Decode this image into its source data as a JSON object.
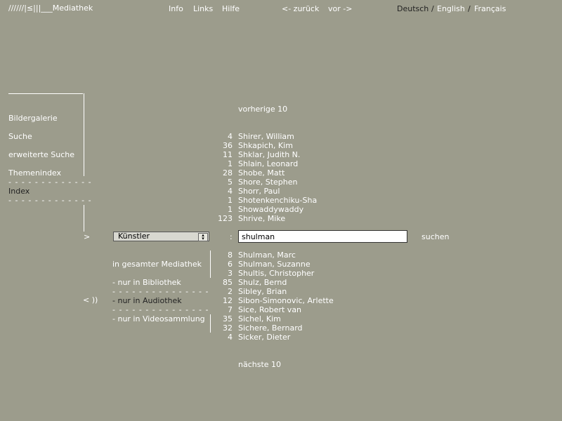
{
  "header": {
    "logo_text": "//////|≤|||",
    "logo_suffix": "___Mediathek",
    "nav": [
      "Info",
      "Links",
      "Hilfe"
    ],
    "back": "<- zurück",
    "forward": "vor ->",
    "lang_de": "Deutsch",
    "lang_sep": "/",
    "lang_en": "English",
    "lang_fr": "Français"
  },
  "sidebar": {
    "gallery": "Bildergalerie",
    "search": "Suche",
    "advanced_search": "erweiterte Suche",
    "topic_index": "Themenindex",
    "index": "Index",
    "dashes": "- - - - - - - - - - - - -",
    "pointer": ">",
    "audio_icon": "< ))"
  },
  "results_top": {
    "prev": "vorherige 10",
    "rows": [
      {
        "count": "4",
        "name": "Shirer, William"
      },
      {
        "count": "36",
        "name": "Shkapich, Kim"
      },
      {
        "count": "11",
        "name": "Shklar, Judith N."
      },
      {
        "count": "1",
        "name": "Shlain, Leonard"
      },
      {
        "count": "28",
        "name": "Shobe, Matt"
      },
      {
        "count": "5",
        "name": "Shore, Stephen"
      },
      {
        "count": "4",
        "name": "Shorr, Paul"
      },
      {
        "count": "1",
        "name": "Shotenkenchiku-Sha"
      },
      {
        "count": "1",
        "name": "Showaddywaddy"
      },
      {
        "count": "123",
        "name": "Shrive, Mike"
      }
    ]
  },
  "search": {
    "category": "Künstler",
    "colon": ":",
    "value": "shulman",
    "submit": "suchen"
  },
  "scope": {
    "all": "in gesamter Mediathek",
    "library": "- nur in Bibliothek",
    "audio": "- nur in Audiothek",
    "video": "- nur in Videosammlung",
    "dashes": "- - - - - - - - - - - - - - -"
  },
  "results_bottom": {
    "rows": [
      {
        "count": "8",
        "name": "Shulman, Marc"
      },
      {
        "count": "6",
        "name": "Shulman, Suzanne"
      },
      {
        "count": "3",
        "name": "Shultis, Christopher"
      },
      {
        "count": "85",
        "name": "Shulz, Bernd"
      },
      {
        "count": "2",
        "name": "Sibley, Brian"
      },
      {
        "count": "12",
        "name": "Sibon-Simonovic, Arlette"
      },
      {
        "count": "7",
        "name": "Sice, Robert van"
      },
      {
        "count": "35",
        "name": "Sichel, Kim"
      },
      {
        "count": "32",
        "name": "Sichere, Bernard"
      },
      {
        "count": "4",
        "name": "Sicker, Dieter"
      }
    ],
    "next": "nächste 10"
  }
}
